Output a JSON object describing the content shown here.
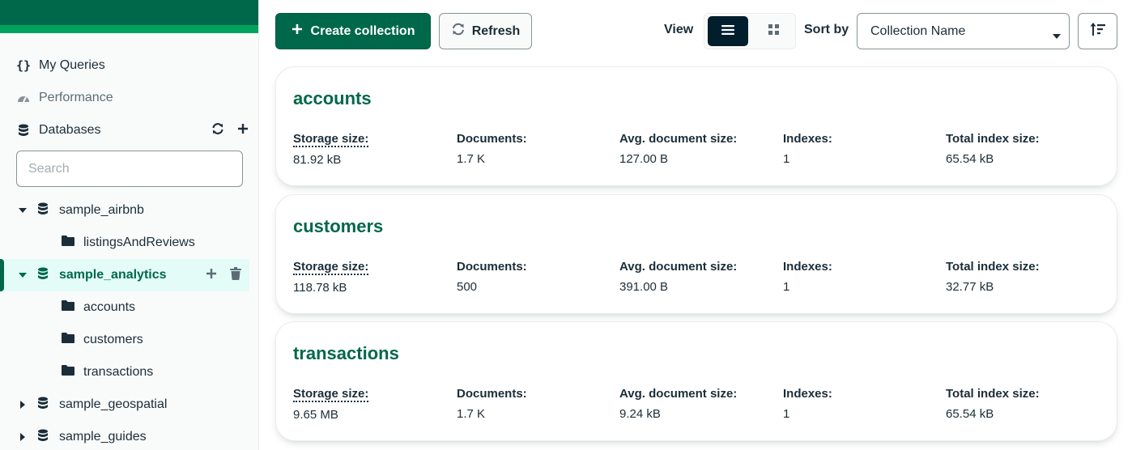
{
  "sidebar": {
    "nav": {
      "my_queries": "My Queries",
      "performance": "Performance",
      "databases": "Databases"
    },
    "search": {
      "placeholder": "Search"
    },
    "tree": {
      "db_airbnb": "sample_airbnb",
      "coll_listings": "listingsAndReviews",
      "db_analytics": "sample_analytics",
      "coll_accounts": "accounts",
      "coll_customers": "customers",
      "coll_transactions": "transactions",
      "db_geospatial": "sample_geospatial",
      "db_guides": "sample_guides"
    }
  },
  "toolbar": {
    "create_label": "Create collection",
    "refresh_label": "Refresh",
    "view_label": "View",
    "sort_label": "Sort by",
    "sort_value": "Collection Name"
  },
  "stat_labels": {
    "storage": "Storage size:",
    "documents": "Documents:",
    "avg_doc": "Avg. document size:",
    "indexes": "Indexes:",
    "total_index": "Total index size:"
  },
  "collections": [
    {
      "name": "accounts",
      "storage": "81.92 kB",
      "documents": "1.7 K",
      "avg_doc": "127.00 B",
      "indexes": "1",
      "total_index": "65.54 kB"
    },
    {
      "name": "customers",
      "storage": "118.78 kB",
      "documents": "500",
      "avg_doc": "391.00 B",
      "indexes": "1",
      "total_index": "32.77 kB"
    },
    {
      "name": "transactions",
      "storage": "9.65 MB",
      "documents": "1.7 K",
      "avg_doc": "9.24 kB",
      "indexes": "1",
      "total_index": "65.54 kB"
    }
  ],
  "colors": {
    "brand": "#00684a",
    "brand_bright": "#00a35c",
    "active_bg": "#e3fcf7",
    "text": "#1c2d38"
  }
}
